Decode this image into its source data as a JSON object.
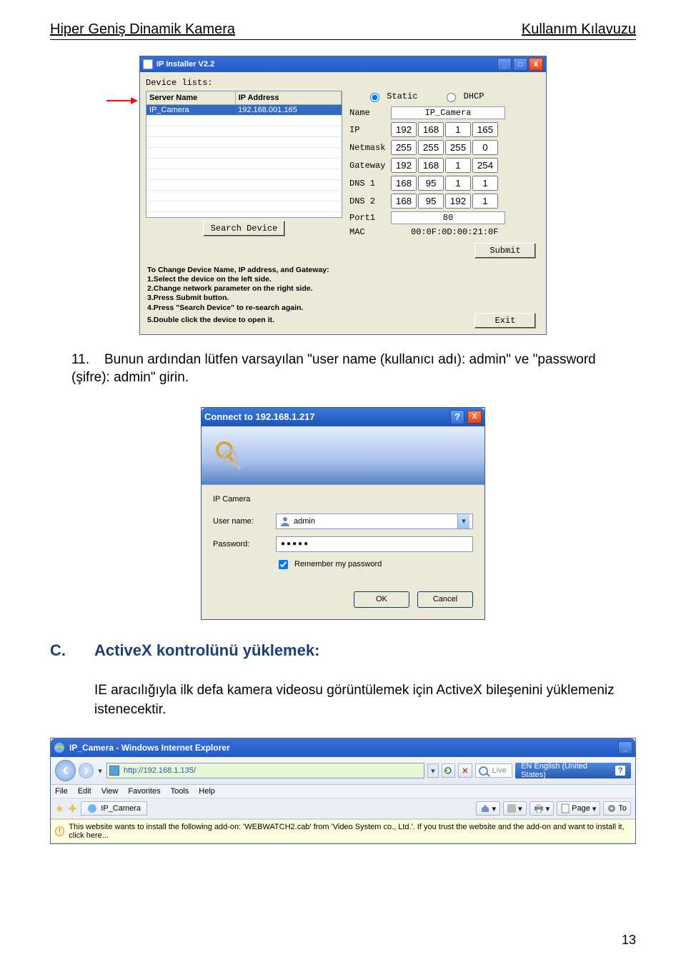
{
  "header": {
    "left": "Hiper Geniş Dinamik Kamera",
    "right": "Kullanım Kılavuzu"
  },
  "ipinstaller": {
    "title": "IP Installer V2.2",
    "device_lists_label": "Device lists:",
    "columns": {
      "server": "Server Name",
      "ip": "IP Address"
    },
    "row": {
      "server": "IP_Camera",
      "ip": "192.168.001.165"
    },
    "radio_static": "Static",
    "radio_dhcp": "DHCP",
    "fields": {
      "name_label": "Name",
      "name_value": "IP_Camera",
      "ip_label": "IP",
      "ip": [
        "192",
        "168",
        "1",
        "165"
      ],
      "netmask_label": "Netmask",
      "netmask": [
        "255",
        "255",
        "255",
        "0"
      ],
      "gateway_label": "Gateway",
      "gateway": [
        "192",
        "168",
        "1",
        "254"
      ],
      "dns1_label": "DNS 1",
      "dns1": [
        "168",
        "95",
        "1",
        "1"
      ],
      "dns2_label": "DNS 2",
      "dns2": [
        "168",
        "95",
        "192",
        "1"
      ],
      "port_label": "Port1",
      "port_value": "80",
      "mac_label": "MAC",
      "mac_value": "00:0F:0D:00:21:0F"
    },
    "search_btn": "Search Device",
    "submit_btn": "Submit",
    "exit_btn": "Exit",
    "instructions_title": "To Change Device Name, IP address, and Gateway:",
    "instructions": [
      "1.Select the device on the left side.",
      "2.Change network parameter on the right side.",
      "3.Press Submit button.",
      "4.Press  \"Search Device\"  to re-search again.",
      "5.Double click the device to open it."
    ]
  },
  "para1": {
    "num": "11.",
    "text": "Bunun ardından lütfen varsayılan \"user name (kullanıcı adı): admin\" ve \"password (şifre): admin\" girin."
  },
  "auth": {
    "title": "Connect to 192.168.1.217",
    "realm": "IP Camera",
    "user_label": "User name:",
    "user_value": "admin",
    "pass_label": "Password:",
    "pass_mask": "●●●●●",
    "remember": "Remember my password",
    "ok": "OK",
    "cancel": "Cancel"
  },
  "section": {
    "letter": "C.",
    "title": "ActiveX kontrolünü yüklemek:"
  },
  "body_text": "IE aracılığıyla ilk defa kamera videosu görüntülemek için ActiveX bileşenini yüklemeniz istenecektir.",
  "ie": {
    "title": "IP_Camera - Windows Internet Explorer",
    "url": "http://192.168.1.135/",
    "live_placeholder": "Live",
    "lang": "EN English (United States)",
    "menu": [
      "File",
      "Edit",
      "View",
      "Favorites",
      "Tools",
      "Help"
    ],
    "tab": "IP_Camera",
    "page_tool": "Page",
    "tools_tool": "To",
    "infobar": "This website wants to install the following add-on: 'WEBWATCH2.cab' from 'Video System co., Ltd.'. If you trust the website and the add-on and want to install it, click here..."
  },
  "page_number": "13"
}
